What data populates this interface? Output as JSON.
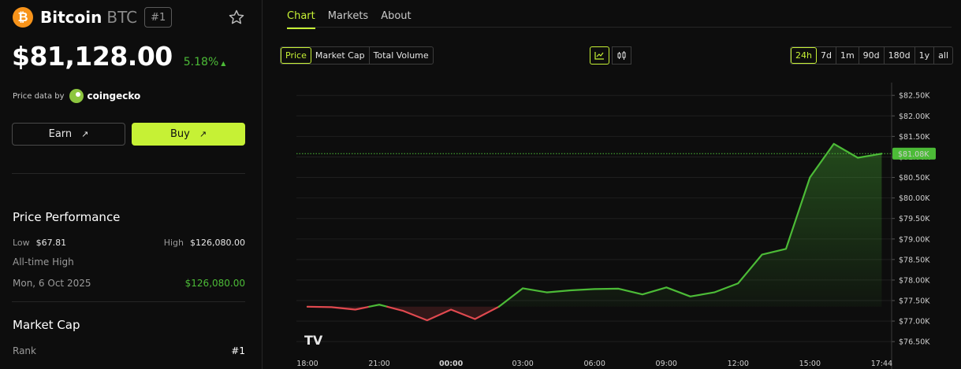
{
  "coin": {
    "name": "Bitcoin",
    "symbol": "BTC",
    "rank_badge": "#1",
    "logo_glyph": "₿",
    "price": "$81,128.00",
    "change": "5.18%",
    "change_arrow": "▲"
  },
  "price_data": {
    "label": "Price data by",
    "source": "coingecko"
  },
  "actions": {
    "earn_label": "Earn",
    "buy_label": "Buy",
    "arrow": "↗"
  },
  "performance": {
    "title": "Price Performance",
    "low_label": "Low",
    "low_value": "$67.81",
    "high_label": "High",
    "high_value": "$126,080.00",
    "ath_label": "All-time High",
    "ath_date": "Mon, 6 Oct 2025",
    "ath_value": "$126,080.00"
  },
  "market_cap": {
    "title": "Market Cap",
    "rank_label": "Rank",
    "rank_value": "#1"
  },
  "tabs": [
    {
      "label": "Chart",
      "active": true
    },
    {
      "label": "Markets",
      "active": false
    },
    {
      "label": "About",
      "active": false
    }
  ],
  "metric_tabs": [
    {
      "label": "Price",
      "active": true
    },
    {
      "label": "Market Cap",
      "active": false
    },
    {
      "label": "Total Volume",
      "active": false
    }
  ],
  "chart_type_icons": [
    {
      "name": "line-chart-icon",
      "active": true
    },
    {
      "name": "candlestick-icon",
      "active": false
    }
  ],
  "range_tabs": [
    {
      "label": "24h",
      "active": true
    },
    {
      "label": "7d",
      "active": false
    },
    {
      "label": "1m",
      "active": false
    },
    {
      "label": "90d",
      "active": false
    },
    {
      "label": "180d",
      "active": false
    },
    {
      "label": "1y",
      "active": false
    },
    {
      "label": "all",
      "active": false
    }
  ],
  "colors": {
    "accent": "#c6f135",
    "up": "#4cbb37",
    "down": "#e0494f",
    "bitcoin": "#f7931a"
  },
  "chart_data": {
    "type": "line",
    "watermark": "TV",
    "x_ticks": [
      {
        "label": "18:00",
        "h": 0
      },
      {
        "label": "21:00",
        "h": 3
      },
      {
        "label": "00:00",
        "h": 6,
        "bold": true
      },
      {
        "label": "03:00",
        "h": 9
      },
      {
        "label": "06:00",
        "h": 12
      },
      {
        "label": "09:00",
        "h": 15
      },
      {
        "label": "12:00",
        "h": 18
      },
      {
        "label": "15:00",
        "h": 21
      },
      {
        "label": "17:44",
        "h": 24
      }
    ],
    "y_ticks": [
      {
        "label": "$76.50K",
        "value": 76.5
      },
      {
        "label": "$77.00K",
        "value": 77.0
      },
      {
        "label": "$77.50K",
        "value": 77.5
      },
      {
        "label": "$78.00K",
        "value": 78.0
      },
      {
        "label": "$78.50K",
        "value": 78.5
      },
      {
        "label": "$79.00K",
        "value": 79.0
      },
      {
        "label": "$79.50K",
        "value": 79.5
      },
      {
        "label": "$80.00K",
        "value": 80.0
      },
      {
        "label": "$80.50K",
        "value": 80.5
      },
      {
        "label": "$81.00K",
        "value": 81.0
      },
      {
        "label": "$81.50K",
        "value": 81.5
      },
      {
        "label": "$82.00K",
        "value": 82.0
      },
      {
        "label": "$82.50K",
        "value": 82.5
      }
    ],
    "ylim": [
      76.35,
      82.6
    ],
    "baseline": 77.35,
    "current_label": "$81.08K",
    "current_value": 81.08,
    "series": [
      {
        "points": [
          [
            -0.5,
            77.35
          ],
          [
            0.5,
            77.34
          ],
          [
            1.5,
            77.28
          ],
          [
            2.5,
            77.4
          ],
          [
            3.5,
            77.25
          ],
          [
            4.5,
            77.02
          ],
          [
            5.5,
            77.28
          ],
          [
            6.5,
            77.05
          ],
          [
            7.5,
            77.35
          ],
          [
            8.5,
            77.8
          ],
          [
            9.5,
            77.7
          ],
          [
            10.5,
            77.75
          ],
          [
            11.5,
            77.78
          ],
          [
            12.5,
            77.79
          ],
          [
            13.5,
            77.65
          ],
          [
            14.5,
            77.82
          ],
          [
            15.5,
            77.6
          ],
          [
            16.5,
            77.7
          ],
          [
            17.5,
            77.92
          ],
          [
            18.5,
            78.62
          ],
          [
            19.5,
            78.76
          ],
          [
            20.5,
            80.5
          ],
          [
            21.5,
            81.32
          ],
          [
            22.5,
            80.98
          ],
          [
            23.5,
            81.08
          ]
        ]
      }
    ]
  }
}
